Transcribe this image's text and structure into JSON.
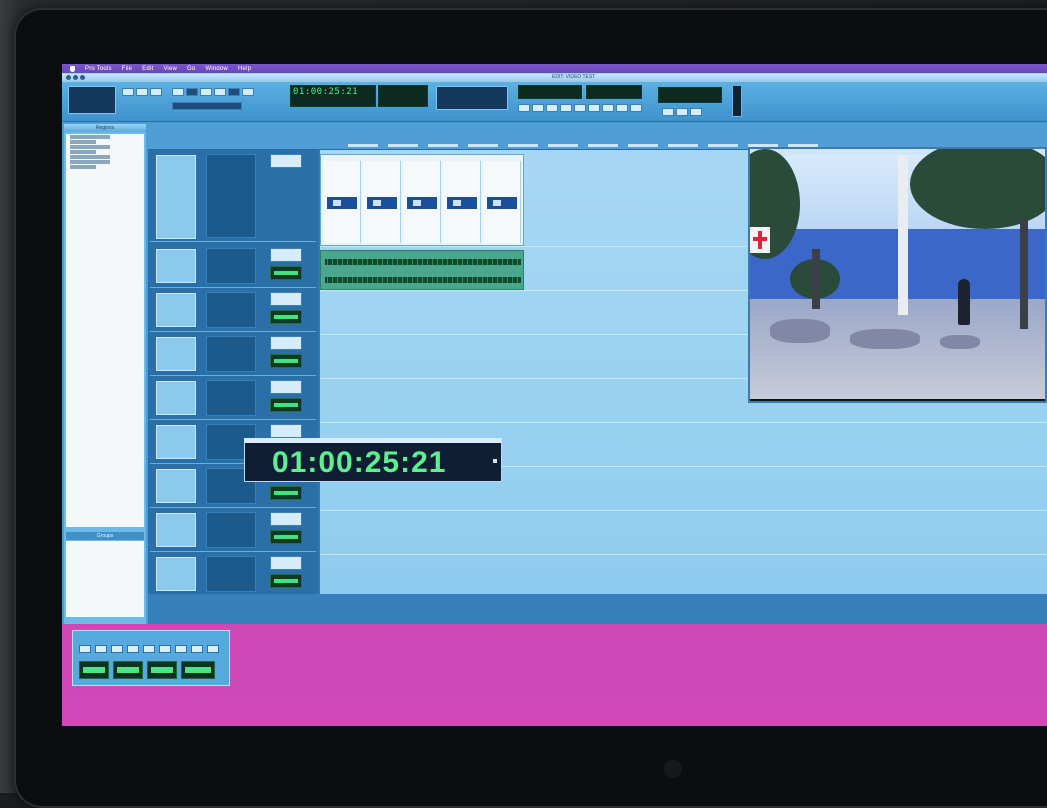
{
  "menubar": {
    "items": [
      "Pro Tools",
      "File",
      "Edit",
      "View",
      "Go",
      "Window",
      "Help"
    ]
  },
  "window": {
    "title": "EDIT: VIDEO TEST"
  },
  "transport": {
    "main_counter": "01:00:25:21",
    "big_counter": "01:00:25:21"
  },
  "panels": {
    "regions_header": "Regions",
    "groups_header": "Groups"
  },
  "colors": {
    "counter_green": "#5cf08f",
    "ui_blue": "#4a9ed3",
    "desktop_magenta": "#c23fae"
  }
}
